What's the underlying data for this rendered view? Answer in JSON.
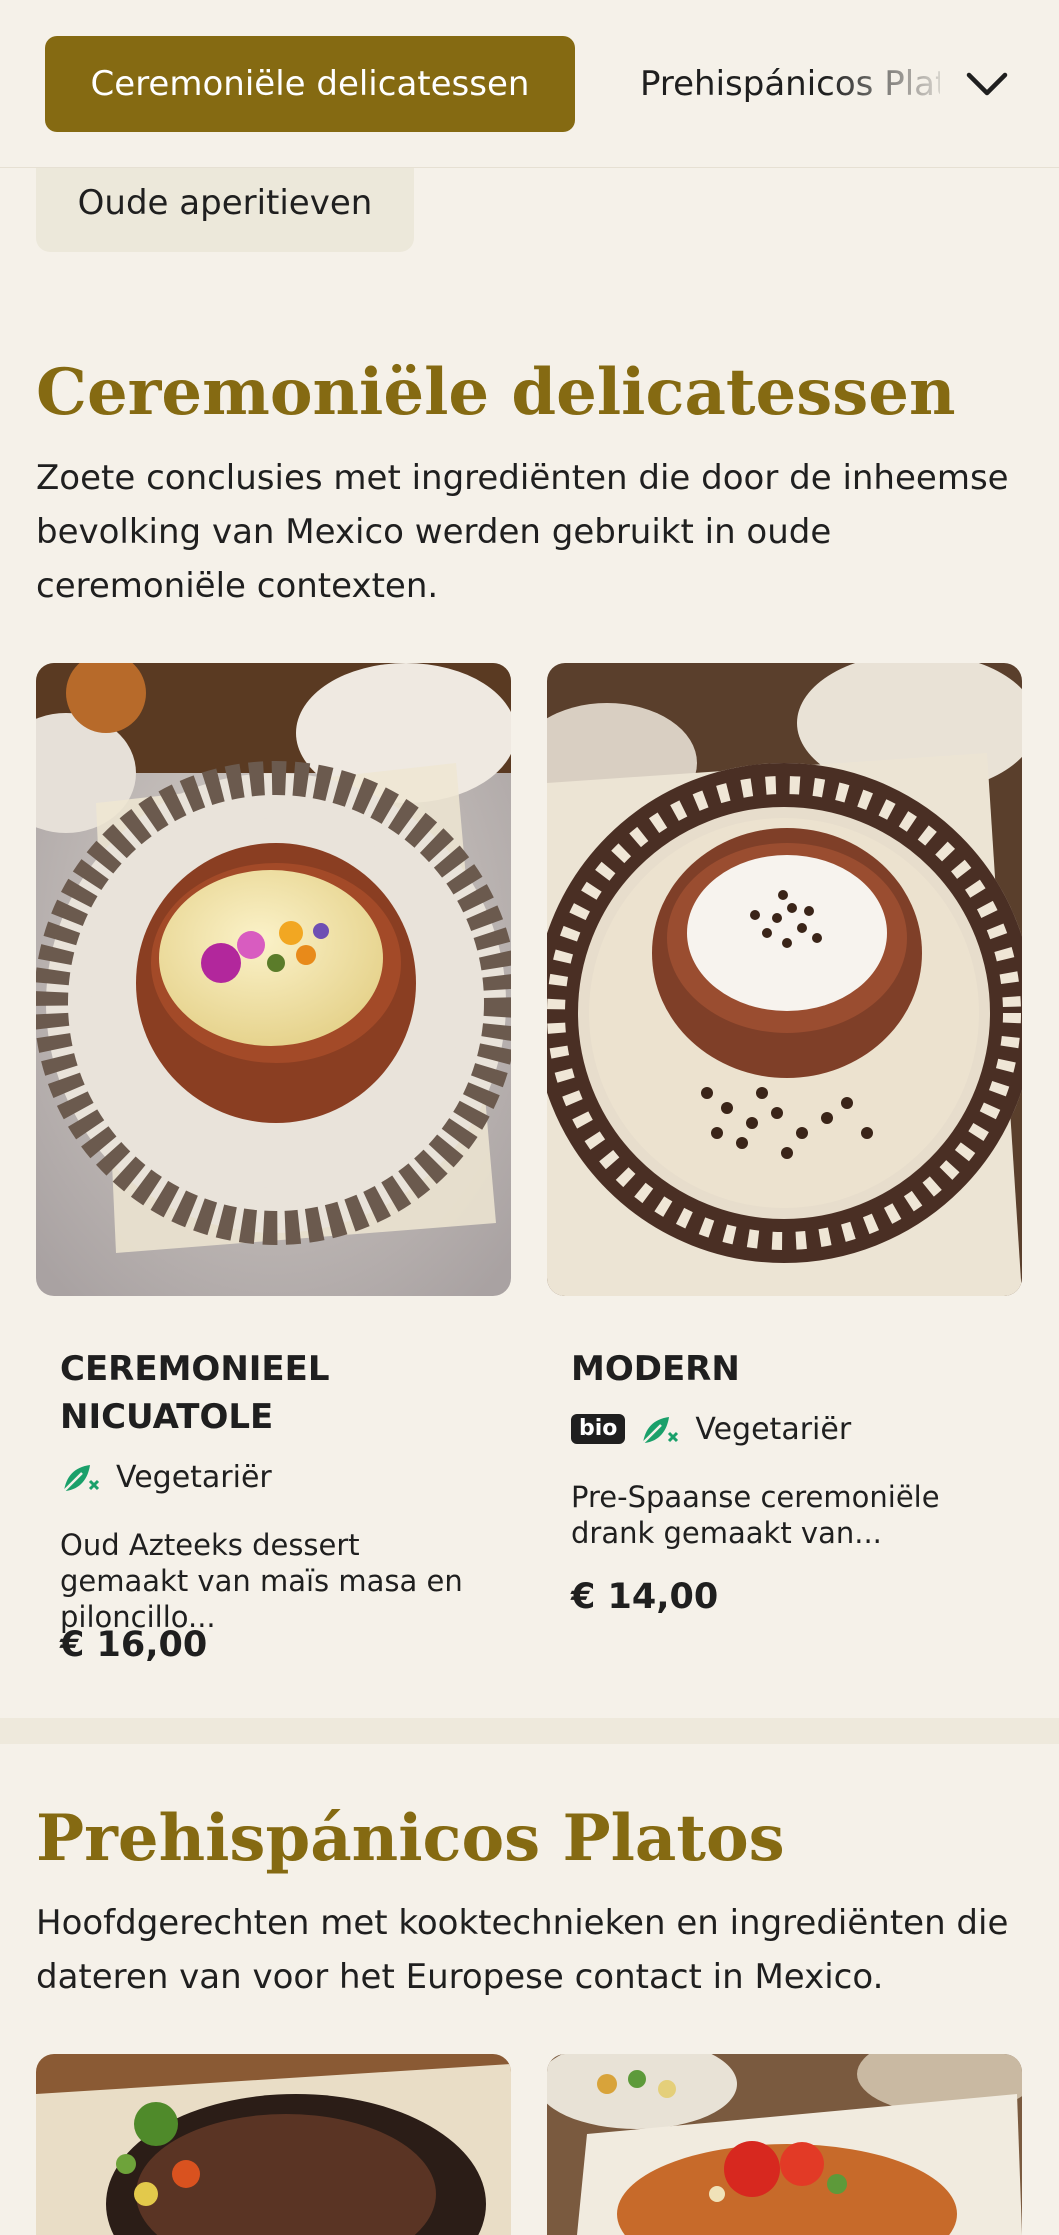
{
  "topbar": {
    "active_category": "Ceremoniële delicatessen",
    "next_category": "Prehispánicos Platos",
    "previous_category": "Oude aperitieven"
  },
  "sections": [
    {
      "title": "Ceremoniële delicatessen",
      "description": "Zoete conclusies met ingrediënten die door de inheemse bevolking van Mexico werden gebruikt in oude ceremoniële contexten.",
      "items": [
        {
          "name": "Ceremonieel Nicuatole",
          "badges": [
            "Vegetariër"
          ],
          "description": "Oud Azteeks dessert gemaakt van maïs masa en piloncillo...",
          "price": "€ 16,00"
        },
        {
          "name": "Modern",
          "badges": [
            "bio",
            "Vegetariër"
          ],
          "description": "Pre-Spaanse ceremoniële drank gemaakt van...",
          "price": "€ 14,00"
        }
      ]
    },
    {
      "title": "Prehispánicos Platos",
      "description": "Hoofdgerechten met kooktechnieken en ingrediënten die dateren van voor het Europese contact in Mexico."
    }
  ],
  "colors": {
    "accent": "#856a12",
    "background": "#f5f1e9",
    "veg_icon": "#1aa06a"
  },
  "icons": {
    "dropdown": "chevron-down-icon",
    "vegetarian": "leaf-icon"
  }
}
